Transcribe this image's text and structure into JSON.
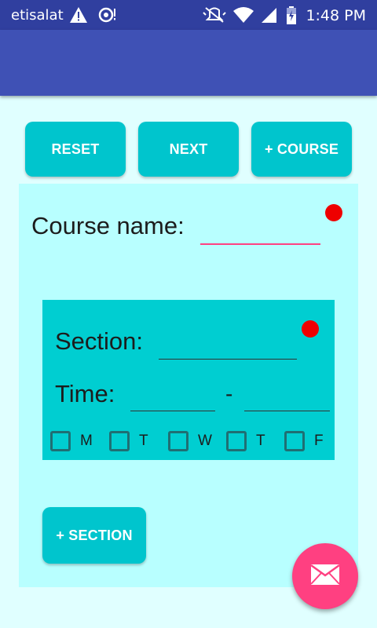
{
  "status_bar": {
    "carrier": "etisalat",
    "time": "1:48 PM",
    "icons": [
      "warning-icon",
      "sync-icon",
      "mute-icon",
      "wifi-icon",
      "signal-icon",
      "battery-icon"
    ]
  },
  "toolbar": {
    "reset_label": "RESET",
    "next_label": "NEXT",
    "add_course_label": "+ COURSE"
  },
  "course": {
    "name_label": "Course name:",
    "name_value": ""
  },
  "section": {
    "section_label": "Section:",
    "section_value": "",
    "time_label": "Time:",
    "time_start": "",
    "time_separator": "-",
    "time_end": "",
    "days": [
      {
        "label": "M",
        "checked": false
      },
      {
        "label": "T",
        "checked": false
      },
      {
        "label": "W",
        "checked": false
      },
      {
        "label": "T",
        "checked": false
      },
      {
        "label": "F",
        "checked": false
      }
    ],
    "add_section_label": "+ SECTION"
  },
  "fab": {
    "icon": "mail-icon"
  },
  "colors": {
    "status_bar": "#303f9f",
    "app_bar": "#3f51b5",
    "accent": "#ff4081",
    "button": "#00c5cd",
    "background": "#e0ffff",
    "course_panel": "#b8ffff",
    "section_panel": "#00ced1",
    "required_dot": "#ee0000"
  }
}
